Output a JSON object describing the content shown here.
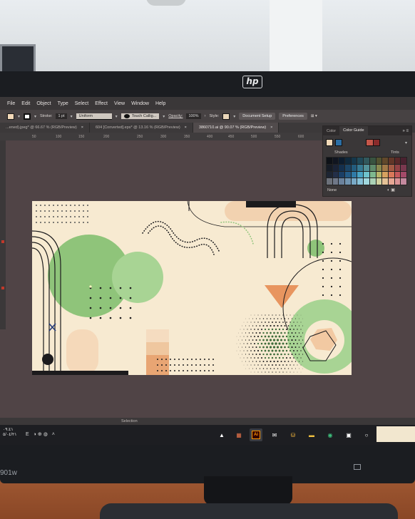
{
  "device": {
    "brand": "hp",
    "model_label": "901w"
  },
  "app": {
    "menu": [
      "File",
      "Edit",
      "Object",
      "Type",
      "Select",
      "Effect",
      "View",
      "Window",
      "Help"
    ],
    "control_bar": {
      "stroke_label": "Stroke:",
      "stroke_value": "1 pt",
      "profile_value": "Uniform",
      "brush_value": "Touch Callig...",
      "opacity_label": "Opacity:",
      "opacity_value": "100%",
      "style_label": "Style:",
      "document_setup": "Document Setup",
      "preferences": "Preferences",
      "fill_color": "#f2d9b8"
    },
    "tabs": [
      {
        "label": "...ened).jpeg* @ 66.67 % (RGB/Preview)",
        "active": false
      },
      {
        "label": "604 [Converted].eps* @ 13.16 % (RGB/Preview)",
        "active": false
      },
      {
        "label": "3860710.ai @ 90.07 % (RGB/Preview)",
        "active": true
      }
    ],
    "ruler": [
      "50",
      "100",
      "150",
      "200",
      "250",
      "300",
      "350",
      "400",
      "450",
      "500",
      "550",
      "600"
    ],
    "panel": {
      "tabs": [
        "Color",
        "Color Guide"
      ],
      "active_tab": "Color Guide",
      "shades_label": "Shades",
      "tints_label": "Tints",
      "none_label": "None",
      "harmony_colors": [
        "#f2d9b8",
        "#2b6ea4",
        "#c6574a",
        "#8a2b2b"
      ],
      "swatch_columns": [
        "#1d2533",
        "#232f48",
        "#1b3f66",
        "#245b86",
        "#2f7aa7",
        "#48a3c4",
        "#6ec3cc",
        "#7eb98f",
        "#b7b66a",
        "#d7a15f",
        "#d9785a",
        "#c5585c",
        "#a34a69"
      ]
    },
    "status": {
      "selection_label": "Selection"
    }
  },
  "taskbar": {
    "time": "‎٠٩:٤١",
    "date": "٥/٠٤/٢١",
    "lang": "E",
    "apps": [
      "explorer",
      "photos",
      "Ai",
      "mail",
      "store",
      "files",
      "edge",
      "settings",
      "circle"
    ]
  },
  "artwork": {
    "colors": {
      "cream": "#f7ead1",
      "green": "#8fc47a",
      "light_green": "#a8d494",
      "peach": "#f2c9a2",
      "orange": "#e8a573",
      "dark": "#1c1b1d"
    }
  }
}
